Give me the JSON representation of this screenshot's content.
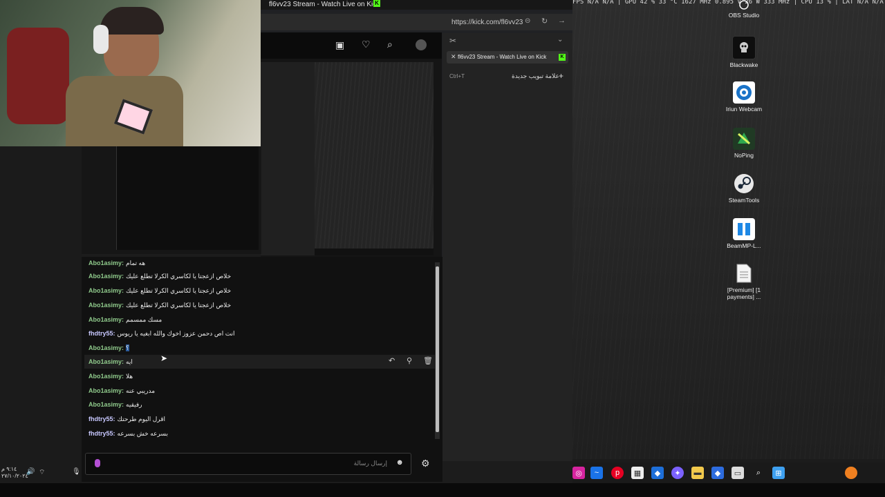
{
  "browser": {
    "title": "fl6vv23 Stream - Watch Live on Kick",
    "url": "https://kick.com/fl6vv23",
    "tab_title": "fl6vv23 Stream - Watch Live on Kick",
    "new_tab_label": "علامة تبويب جديدة",
    "new_tab_shortcut": "Ctrl+T"
  },
  "system_stats": "FPS N/A N/A | GPU 42 % 33 °C 1627 MHz 0.895 V 26 W 333 MHz | CPU 13 % | LAT N/A N/A",
  "desktop_icons": [
    {
      "label": "OBS Studio",
      "icon": "obs-icon",
      "color": "#ffffff"
    },
    {
      "label": "Blackwake",
      "icon": "blackwake-icon",
      "color": "#000000"
    },
    {
      "label": "Iriun Webcam",
      "icon": "webcam-icon",
      "color": "#1a73c8"
    },
    {
      "label": "NoPing",
      "icon": "noping-icon",
      "color": "#2fa84f"
    },
    {
      "label": "SteamTools",
      "icon": "steam-icon",
      "color": "#1b2838"
    },
    {
      "label": "BeamMP-L...",
      "icon": "beammp-icon",
      "color": "#1e88e5"
    },
    {
      "label": "[Premium] [1 payments] ...",
      "icon": "file-icon",
      "color": "#eeeeee"
    }
  ],
  "chat": {
    "input_placeholder": "إرسال رسالة",
    "messages": [
      {
        "user": "Abo1asimy:",
        "text": "هه تمام",
        "cls": ""
      },
      {
        "user": "Abo1asimy:",
        "text": "خلاص ازعجتا يا لكاسري الكرلا تطلع عليك",
        "cls": ""
      },
      {
        "user": "Abo1asimy:",
        "text": "خلاص ازعجتا يا لكاسري الكرلا تطلع عليك",
        "cls": ""
      },
      {
        "user": "Abo1asimy:",
        "text": "خلاص ازعجتا يا لكاسري الكرلا تطلع عليك",
        "cls": ""
      },
      {
        "user": "Abo1asimy:",
        "text": "مسك ممسمم",
        "cls": ""
      },
      {
        "user": "fhdtry55:",
        "text": "انت اص دحمن عزوز اخوك والله ابغيه يا ريوس",
        "cls": "purple"
      },
      {
        "user": "Abo1asimy:",
        "text": "؟",
        "cls": ""
      },
      {
        "user": "Abo1asimy:",
        "text": "ايه",
        "cls": ""
      },
      {
        "user": "Abo1asimy:",
        "text": "هلا",
        "cls": ""
      },
      {
        "user": "Abo1asimy:",
        "text": "مدريبي عنه",
        "cls": ""
      },
      {
        "user": "Abo1asimy:",
        "text": "رفيقيه",
        "cls": ""
      },
      {
        "user": "fhdtry55:",
        "text": "اقرل اليوم طرحتك",
        "cls": "purple"
      },
      {
        "user": "fhdtry55:",
        "text": "بسرعه خش بسرعه",
        "cls": "purple"
      }
    ]
  },
  "taskbar_left": {
    "date": "٢٧/١٠/٢٠٢٤",
    "time": "٩:١٤ م"
  }
}
